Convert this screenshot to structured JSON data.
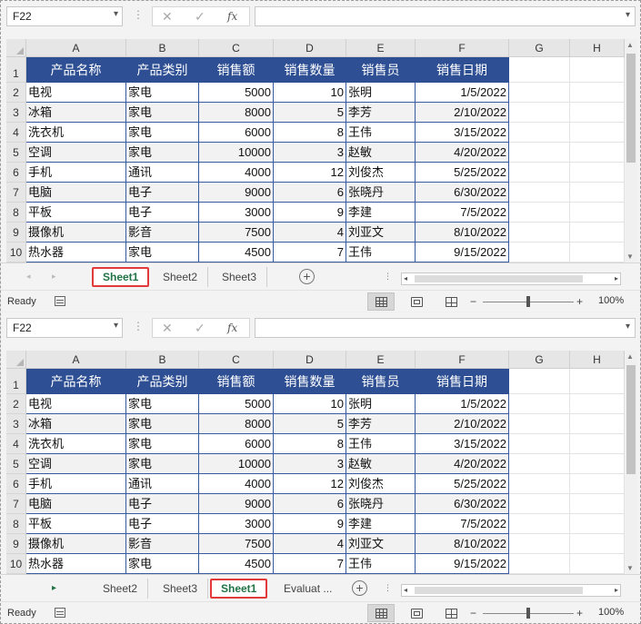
{
  "panels": [
    {
      "name_box": "F22",
      "columns": [
        "A",
        "B",
        "C",
        "D",
        "E",
        "F",
        "G",
        "H"
      ],
      "headers": [
        "产品名称",
        "产品类别",
        "销售额",
        "销售数量",
        "销售员",
        "销售日期"
      ],
      "rows": [
        [
          "电视",
          "家电",
          "5000",
          "10",
          "张明",
          "1/5/2022"
        ],
        [
          "冰箱",
          "家电",
          "8000",
          "5",
          "李芳",
          "2/10/2022"
        ],
        [
          "洗衣机",
          "家电",
          "6000",
          "8",
          "王伟",
          "3/15/2022"
        ],
        [
          "空调",
          "家电",
          "10000",
          "3",
          "赵敏",
          "4/20/2022"
        ],
        [
          "手机",
          "通讯",
          "4000",
          "12",
          "刘俊杰",
          "5/25/2022"
        ],
        [
          "电脑",
          "电子",
          "9000",
          "6",
          "张晓丹",
          "6/30/2022"
        ],
        [
          "平板",
          "电子",
          "3000",
          "9",
          "李建",
          "7/5/2022"
        ],
        [
          "摄像机",
          "影音",
          "7500",
          "4",
          "刘亚文",
          "8/10/2022"
        ],
        [
          "热水器",
          "家电",
          "4500",
          "7",
          "王伟",
          "9/15/2022"
        ]
      ],
      "row_numbers": [
        "1",
        "2",
        "3",
        "4",
        "5",
        "6",
        "7",
        "8",
        "9",
        "10"
      ],
      "tabs": [
        "Sheet1",
        "Sheet2",
        "Sheet3"
      ],
      "active_tab": "Sheet1",
      "status": "Ready",
      "zoom": "100%"
    },
    {
      "name_box": "F22",
      "columns": [
        "A",
        "B",
        "C",
        "D",
        "E",
        "F",
        "G",
        "H"
      ],
      "headers": [
        "产品名称",
        "产品类别",
        "销售额",
        "销售数量",
        "销售员",
        "销售日期"
      ],
      "rows": [
        [
          "电视",
          "家电",
          "5000",
          "10",
          "张明",
          "1/5/2022"
        ],
        [
          "冰箱",
          "家电",
          "8000",
          "5",
          "李芳",
          "2/10/2022"
        ],
        [
          "洗衣机",
          "家电",
          "6000",
          "8",
          "王伟",
          "3/15/2022"
        ],
        [
          "空调",
          "家电",
          "10000",
          "3",
          "赵敏",
          "4/20/2022"
        ],
        [
          "手机",
          "通讯",
          "4000",
          "12",
          "刘俊杰",
          "5/25/2022"
        ],
        [
          "电脑",
          "电子",
          "9000",
          "6",
          "张晓丹",
          "6/30/2022"
        ],
        [
          "平板",
          "电子",
          "3000",
          "9",
          "李建",
          "7/5/2022"
        ],
        [
          "摄像机",
          "影音",
          "7500",
          "4",
          "刘亚文",
          "8/10/2022"
        ],
        [
          "热水器",
          "家电",
          "4500",
          "7",
          "王伟",
          "9/15/2022"
        ]
      ],
      "row_numbers": [
        "1",
        "2",
        "3",
        "4",
        "5",
        "6",
        "7",
        "8",
        "9",
        "10"
      ],
      "tabs": [
        "Sheet2",
        "Sheet3",
        "Sheet1",
        "Evaluat ..."
      ],
      "active_tab": "Sheet1",
      "status": "Ready",
      "zoom": "100%"
    }
  ],
  "icons": {
    "cancel": "✕",
    "enter": "✓",
    "function": "fx",
    "dropdown": "▾",
    "nav_left": "◂",
    "nav_right": "▸",
    "add_sheet": "+",
    "more": "⋮"
  },
  "colors": {
    "header_fill": "#2e4f94",
    "header_text": "#ffffff",
    "active_tab_text": "#217346",
    "highlight_border": "#e23a3a",
    "alt_row": "#f2f2f2"
  }
}
